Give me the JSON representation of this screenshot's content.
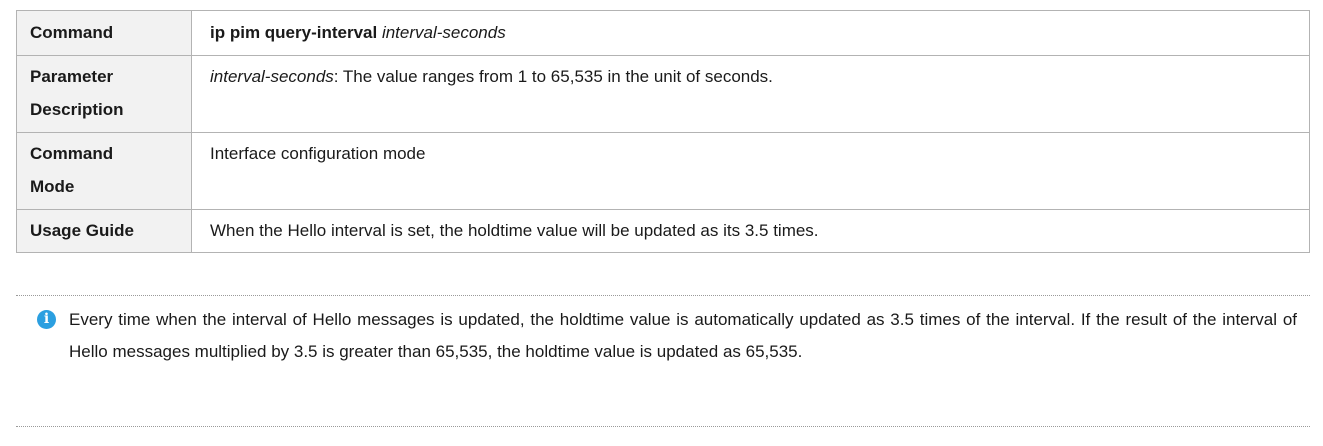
{
  "table": {
    "rows": [
      {
        "label": "Command",
        "value_bold": "ip pim query-interval",
        "value_italic": "interval-seconds"
      },
      {
        "label_line1": "Parameter",
        "label_line2": "Description",
        "value_italic": "interval-seconds",
        "value_rest": ": The value ranges from 1 to 65,535 in the unit of seconds."
      },
      {
        "label_line1": "Command",
        "label_line2": "Mode",
        "value": "Interface configuration mode"
      },
      {
        "label": "Usage Guide",
        "value": "When the Hello interval is set, the holdtime value will be updated as its 3.5 times."
      }
    ]
  },
  "note": {
    "icon": "info-icon",
    "icon_glyph": "i",
    "icon_color": "#2b9fe0",
    "text": "Every time when the interval of Hello messages is updated, the holdtime value is automatically updated as 3.5 times of the interval. If the result of the interval of Hello messages multiplied by 3.5 is greater than 65,535, the holdtime value is updated as 65,535."
  }
}
